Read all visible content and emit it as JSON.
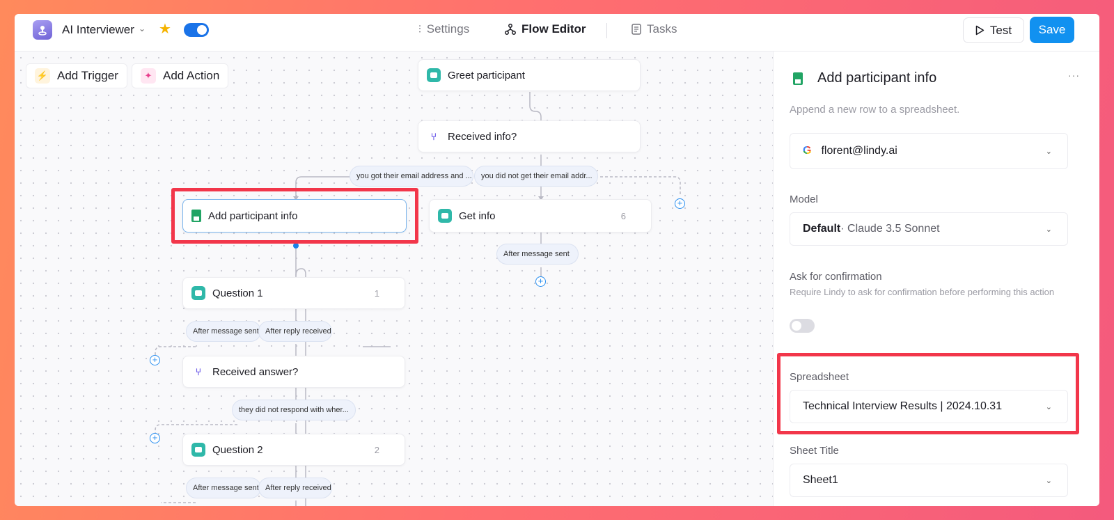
{
  "header": {
    "app_name": "AI Interviewer",
    "nav": {
      "settings": "Settings",
      "flow_editor": "Flow Editor",
      "tasks": "Tasks"
    },
    "test_label": "Test",
    "save_label": "Save"
  },
  "toolbar": {
    "add_trigger": "Add Trigger",
    "add_action": "Add Action"
  },
  "flow": {
    "greet": "Greet participant",
    "received_info": "Received info?",
    "branch_yes": "you got their email address and ...",
    "branch_no": "you did not get their email addr...",
    "add_participant": "Add participant info",
    "get_info": "Get info",
    "get_info_count": "6",
    "after_message_sent": "After message sent",
    "after_reply_received": "After reply received",
    "question1": "Question 1",
    "question1_count": "1",
    "received_answer": "Received answer?",
    "no_response": "they did not respond with wher...",
    "question2": "Question 2",
    "question2_count": "2"
  },
  "panel": {
    "title": "Add participant info",
    "description": "Append a new row to a spreadsheet.",
    "account": "florent@lindy.ai",
    "model_label": "Model",
    "model_value": "Default",
    "model_detail": " · Claude 3.5 Sonnet",
    "confirm_label": "Ask for confirmation",
    "confirm_help": "Require Lindy to ask for confirmation before performing this action",
    "confirm_enabled": false,
    "spreadsheet_label": "Spreadsheet",
    "spreadsheet_value": "Technical Interview Results | 2024.10.31",
    "sheet_title_label": "Sheet Title",
    "sheet_title_value": "Sheet1"
  },
  "colors": {
    "accent": "#1191f0",
    "highlight": "#f2364a",
    "brand": "#6f62d6"
  }
}
